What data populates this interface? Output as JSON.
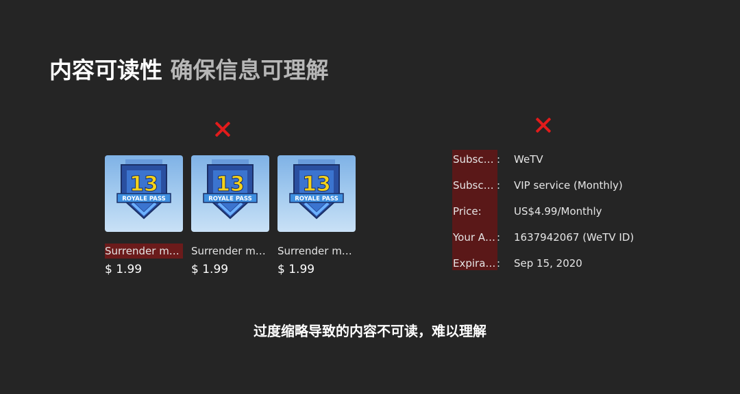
{
  "title": {
    "part1": "内容可读性",
    "part2": "确保信息可理解"
  },
  "colors": {
    "background": "#252525",
    "cross": "#e21b1b",
    "highlight": "#6b1b1b"
  },
  "left_example": {
    "mark_icon": "cross-icon",
    "items": [
      {
        "name": "Surrender m…",
        "price": "$ 1.99",
        "badge_number": "13",
        "badge_text": "ROYALE PASS"
      },
      {
        "name": "Surrender m…",
        "price": "$ 1.99",
        "badge_number": "13",
        "badge_text": "ROYALE PASS"
      },
      {
        "name": "Surrender m…",
        "price": "$ 1.99",
        "badge_number": "13",
        "badge_text": "ROYALE PASS"
      }
    ]
  },
  "right_example": {
    "mark_icon": "cross-icon",
    "rows": [
      {
        "label": "Subsc…",
        "colon": ":",
        "value": "WeTV"
      },
      {
        "label": "Subsc…",
        "colon": ":",
        "value": "VIP service (Monthly)"
      },
      {
        "label": "Price:",
        "colon": "",
        "value": "US$4.99/Monthly"
      },
      {
        "label": "Your A…",
        "colon": ":",
        "value": "1637942067 (WeTV ID)"
      },
      {
        "label": "Expira…",
        "colon": ":",
        "value": "Sep 15, 2020"
      }
    ]
  },
  "caption": "过度缩略导致的内容不可读，难以理解"
}
